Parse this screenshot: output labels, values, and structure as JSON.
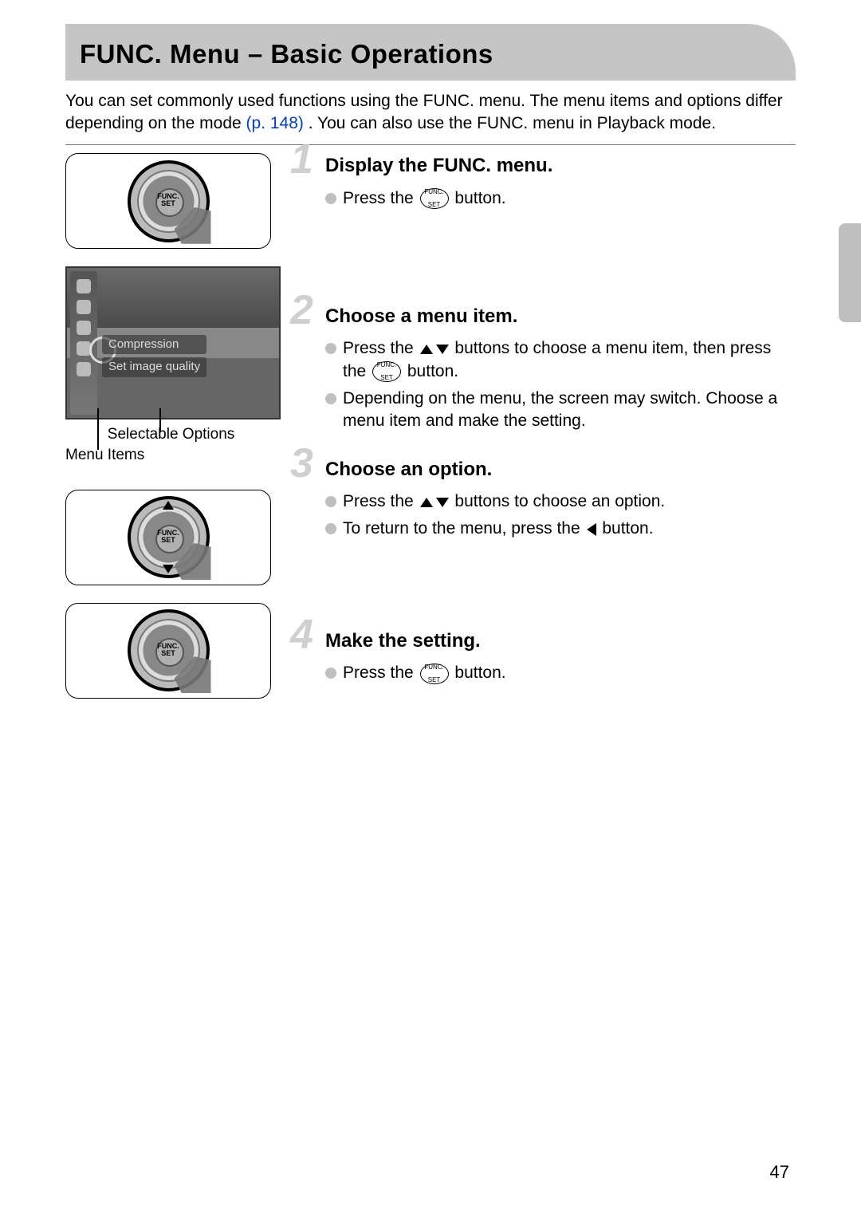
{
  "title": "FUNC. Menu – Basic Operations",
  "intro_pre": "You can set commonly used functions using the FUNC. menu. The menu items and options differ depending on the mode ",
  "page_ref": "(p. 148)",
  "intro_post": ". You can also use the FUNC. menu in Playback mode.",
  "screenshot": {
    "label_top": "Compression",
    "label_bottom": "Set image quality",
    "callout_options": "Selectable Options",
    "callout_items": "Menu Items"
  },
  "func_set_btn": {
    "line1": "FUNC.",
    "line2": "SET"
  },
  "steps": [
    {
      "num": "1",
      "title": "Display the FUNC. menu.",
      "lines": [
        {
          "pre": "Press the ",
          "insert": "funcset",
          "post": " button."
        }
      ]
    },
    {
      "num": "2",
      "title": "Choose a menu item.",
      "lines": [
        {
          "pre": "Press the ",
          "insert": "updown",
          "mid": " buttons to choose a menu item, then press the ",
          "insert2": "funcset",
          "post": " button."
        },
        {
          "pre": "Depending on the menu, the screen may switch. Choose a menu item and make the setting."
        }
      ]
    },
    {
      "num": "3",
      "title": "Choose an option.",
      "lines": [
        {
          "pre": "Press the ",
          "insert": "updown",
          "post": " buttons to choose an option."
        },
        {
          "pre": "To return to the menu, press the ",
          "insert": "left",
          "post": " button."
        }
      ]
    },
    {
      "num": "4",
      "title": "Make the setting.",
      "lines": [
        {
          "pre": "Press the ",
          "insert": "funcset",
          "post": " button."
        }
      ]
    }
  ],
  "page_number": "47"
}
